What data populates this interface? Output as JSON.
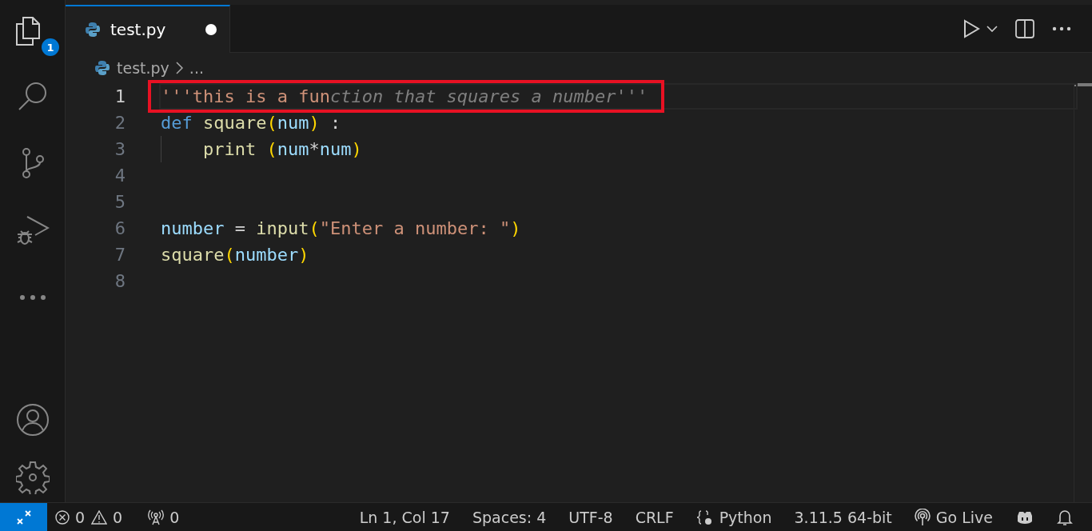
{
  "activity_bar": {
    "explorer_badge": "1"
  },
  "tabs": [
    {
      "label": "test.py",
      "selected": true,
      "modified": true
    }
  ],
  "breadcrumb": {
    "file": "test.py",
    "more": "..."
  },
  "editor": {
    "lines": [
      {
        "number": "1",
        "active": true,
        "highlighted": true,
        "indented": false,
        "tokens": [
          {
            "text": "'''this is a fun",
            "kind": "string"
          },
          {
            "text": "ction that squares a number'''",
            "kind": "ghost"
          }
        ]
      },
      {
        "number": "2",
        "active": false,
        "highlighted": false,
        "indented": false,
        "tokens": [
          {
            "text": "def",
            "kind": "keyword"
          },
          {
            "text": " square",
            "kind": "function"
          },
          {
            "text": "(",
            "kind": "bracket"
          },
          {
            "text": "num",
            "kind": "variable"
          },
          {
            "text": ")",
            "kind": "bracket"
          },
          {
            "text": " :",
            "kind": "plain"
          }
        ]
      },
      {
        "number": "3",
        "active": false,
        "highlighted": false,
        "indented": true,
        "tokens": [
          {
            "text": "print",
            "kind": "function"
          },
          {
            "text": " (",
            "kind": "bracket"
          },
          {
            "text": "num",
            "kind": "variable"
          },
          {
            "text": "*",
            "kind": "plain"
          },
          {
            "text": "num",
            "kind": "variable"
          },
          {
            "text": ")",
            "kind": "bracket"
          }
        ]
      },
      {
        "number": "4",
        "active": false,
        "highlighted": false,
        "indented": false
      },
      {
        "number": "5",
        "active": false,
        "highlighted": false,
        "indented": false
      },
      {
        "number": "6",
        "active": false,
        "highlighted": false,
        "indented": false,
        "tokens": [
          {
            "text": "number",
            "kind": "variable"
          },
          {
            "text": " = ",
            "kind": "plain"
          },
          {
            "text": "input",
            "kind": "function"
          },
          {
            "text": "(",
            "kind": "bracket"
          },
          {
            "text": "\"Enter a number: \"",
            "kind": "string"
          },
          {
            "text": ")",
            "kind": "bracket"
          }
        ]
      },
      {
        "number": "7",
        "active": false,
        "highlighted": false,
        "indented": false,
        "tokens": [
          {
            "text": "square",
            "kind": "function"
          },
          {
            "text": "(",
            "kind": "bracket"
          },
          {
            "text": "number",
            "kind": "variable"
          },
          {
            "text": ")",
            "kind": "bracket"
          }
        ]
      },
      {
        "number": "8",
        "active": false,
        "highlighted": false,
        "indented": false
      }
    ]
  },
  "status_bar": {
    "problems": [
      {
        "text": "0"
      },
      {
        "text": "0"
      }
    ],
    "ports": "0",
    "right": [
      "Ln 1, Col 17",
      "Spaces: 4",
      "UTF-8",
      "CRLF",
      "Python",
      "3.11.5 64-bit",
      "Go Live"
    ]
  }
}
